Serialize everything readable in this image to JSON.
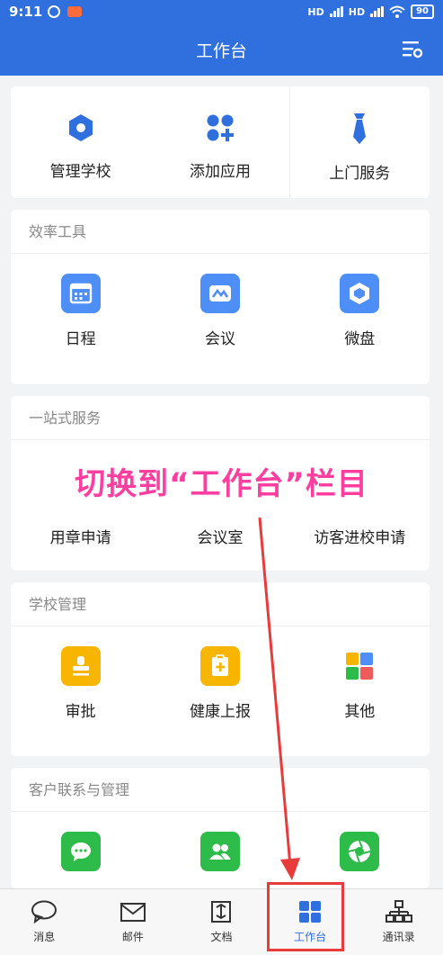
{
  "status": {
    "time": "9:11",
    "signal1": "HD",
    "signal2": "HD",
    "battery": "90"
  },
  "header": {
    "title": "工作台"
  },
  "top_actions": [
    {
      "label": "管理学校",
      "icon": "hexagon-icon"
    },
    {
      "label": "添加应用",
      "icon": "add-app-icon"
    },
    {
      "label": "上门服务",
      "icon": "tie-icon"
    }
  ],
  "efficiency": {
    "title": "效率工具",
    "items": [
      {
        "label": "日程",
        "icon": "calendar-icon"
      },
      {
        "label": "会议",
        "icon": "meeting-icon"
      },
      {
        "label": "微盘",
        "icon": "drive-icon"
      }
    ]
  },
  "one_stop": {
    "title": "一站式服务",
    "items": [
      {
        "label": "用章申请"
      },
      {
        "label": "会议室"
      },
      {
        "label": "访客进校申请"
      }
    ]
  },
  "school_mgmt": {
    "title": "学校管理",
    "items": [
      {
        "label": "审批",
        "icon": "stamp-icon"
      },
      {
        "label": "健康上报",
        "icon": "health-report-icon"
      },
      {
        "label": "其他",
        "icon": "other-apps-icon"
      }
    ]
  },
  "client_mgmt": {
    "title": "客户联系与管理",
    "items": [
      {
        "icon": "chat-icon"
      },
      {
        "icon": "contacts-icon"
      },
      {
        "icon": "moments-icon"
      }
    ]
  },
  "overlay": {
    "text": "切换到“工作台”栏目"
  },
  "tabs": [
    {
      "label": "消息",
      "icon": "message-icon"
    },
    {
      "label": "邮件",
      "icon": "mail-icon"
    },
    {
      "label": "文档",
      "icon": "document-icon"
    },
    {
      "label": "工作台",
      "icon": "workbench-icon",
      "active": true
    },
    {
      "label": "通讯录",
      "icon": "org-chart-icon"
    }
  ],
  "colors": {
    "primary": "#2f6fde",
    "yellow": "#f7b500",
    "green": "#2dbb4a",
    "overlay": "#ff3fa0",
    "annotation": "#e83c3c"
  }
}
